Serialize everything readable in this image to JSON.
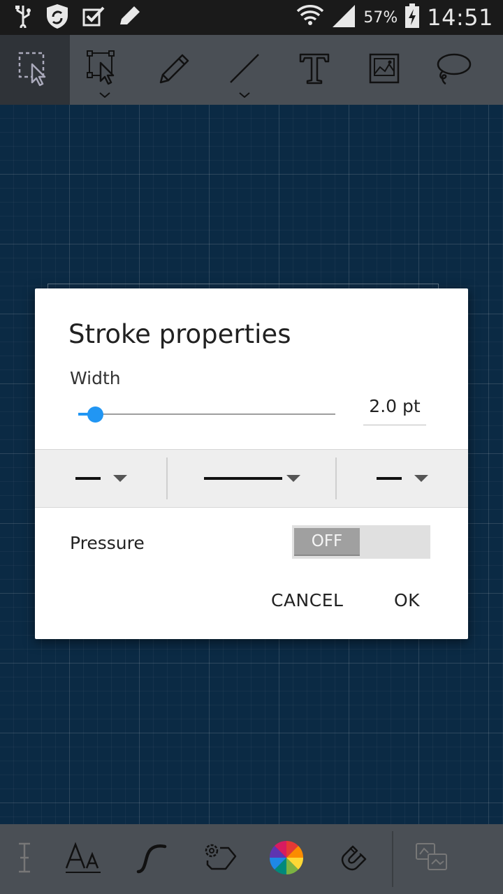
{
  "status_bar": {
    "battery_percent": "57%",
    "time": "14:51",
    "icons": [
      "usb-icon",
      "shield-sync-icon",
      "checkbox-icon",
      "pencil-notify-icon",
      "wifi-icon",
      "signal-icon",
      "battery-charging-icon"
    ]
  },
  "toolbar": {
    "tools": [
      {
        "name": "select-area-tool",
        "icon": "dashed-select-icon",
        "active": true
      },
      {
        "name": "node-select-tool",
        "icon": "node-pointer-icon",
        "active": false
      },
      {
        "name": "pencil-tool",
        "icon": "pencil-icon",
        "active": false
      },
      {
        "name": "line-tool",
        "icon": "line-icon",
        "active": false
      },
      {
        "name": "text-tool",
        "icon": "text-icon",
        "active": false
      },
      {
        "name": "image-tool",
        "icon": "image-icon",
        "active": false
      },
      {
        "name": "lasso-tool",
        "icon": "lasso-icon",
        "active": false
      }
    ]
  },
  "dialog": {
    "title": "Stroke properties",
    "width_label": "Width",
    "width_value": "2.0 pt",
    "width_slider_fraction": 0.065,
    "pressure_label": "Pressure",
    "pressure_toggle": "OFF",
    "cancel_label": "CANCEL",
    "ok_label": "OK"
  },
  "bottom_toolbar": {
    "tools": [
      "text-cursor-icon",
      "font-size-icon",
      "curve-icon",
      "settings-tag-icon",
      "color-wheel-icon",
      "magnet-icon",
      "shapes-icon"
    ]
  },
  "colors": {
    "accent": "#2196f3",
    "canvas": "#0b2a44",
    "toolbar": "#4a4f55"
  }
}
